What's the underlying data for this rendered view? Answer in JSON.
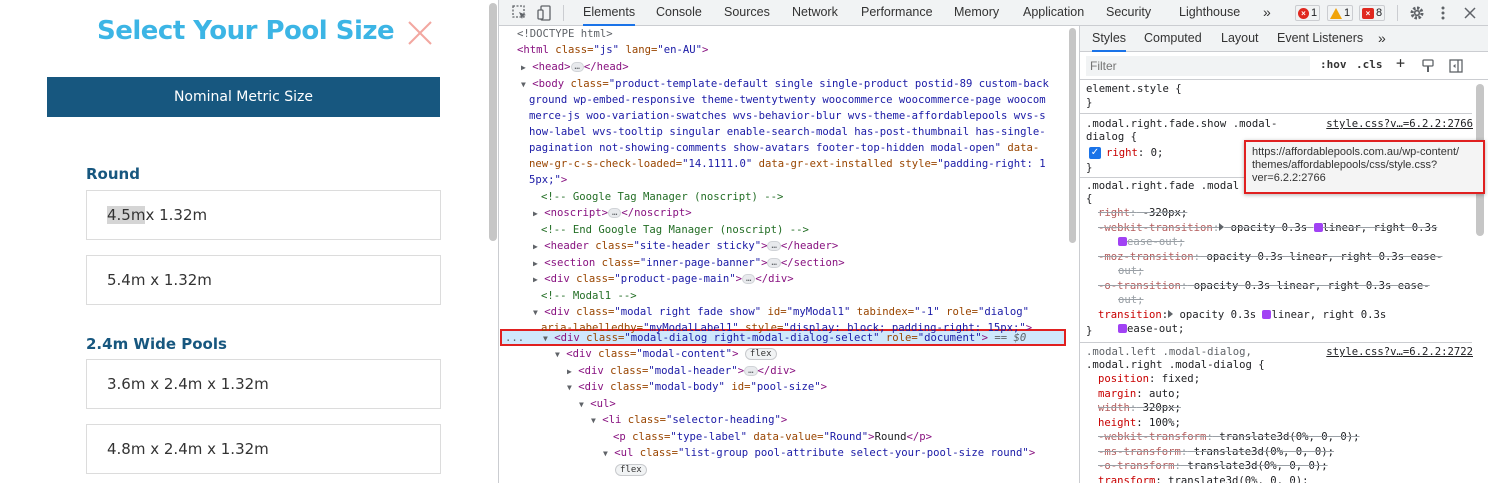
{
  "page": {
    "title": "Select Your Pool Size",
    "metric_button": "Nominal Metric Size",
    "sections": [
      {
        "heading": "Round",
        "options": [
          "4.5m x 1.32m",
          "5.4m x 1.32m"
        ]
      },
      {
        "heading": "2.4m Wide Pools",
        "options": [
          "3.6m x 2.4m x 1.32m",
          "4.8m x 2.4m x 1.32m"
        ]
      }
    ],
    "highlight_prefix": "4.5m",
    "highlight_suffix": " x 1.32m"
  },
  "devtools": {
    "tabs": [
      "Elements",
      "Console",
      "Sources",
      "Network",
      "Performance",
      "Memory",
      "Application",
      "Security",
      "Lighthouse"
    ],
    "more_tabs": "»",
    "badges": {
      "errors": "1",
      "warnings": "1",
      "issues": "8"
    },
    "elements": {
      "doctype": "<!DOCTYPE html>",
      "html_open": [
        "<html",
        " class=",
        "\"js\"",
        " lang=",
        "\"en-AU\"",
        ">"
      ],
      "head": [
        "<head>",
        "</head>"
      ],
      "body_lines": [
        "product-template-default single single-product postid-89 custom-back",
        "ground wp-embed-responsive theme-twentytwenty woocommerce woocommerce-page woocom",
        "merce-js woo-variation-swatches wvs-behavior-blur wvs-theme-affordablepools wvs-s",
        "how-label wvs-tooltip singular enable-search-modal has-post-thumbnail has-single-",
        "pagination not-showing-comments show-avatars footer-top-hidden modal-open\"",
        "new-gr-c-s-check-loaded=",
        "\"14.1111.0\"",
        "data-gr-ext-installed",
        "style=",
        "\"padding-right: 1",
        "5px;\""
      ],
      "comment_gtm": "<!-- Google Tag Manager (noscript) -->",
      "noscript": [
        "<noscript>",
        "</noscript>"
      ],
      "comment_gtm_end": "<!-- End Google Tag Manager (noscript) -->",
      "header_tag": [
        "<header",
        " class=",
        "\"site-header sticky\"",
        ">",
        "</header>"
      ],
      "section_tag": [
        "<section",
        " class=",
        "\"inner-page-banner\"",
        ">",
        "</section>"
      ],
      "div_main": [
        "<div",
        " class=",
        "\"product-page-main\"",
        ">",
        "</div>"
      ],
      "comment_modal": "<!-- Modal1 -->",
      "modal_line1": [
        "<div",
        " class=",
        "\"modal right fade show\"",
        " id=",
        "\"myModal1\"",
        " tabindex=",
        "\"-1\"",
        " role=",
        "\"dialog\""
      ],
      "modal_line2": [
        "aria-labelledby=",
        "\"myModalLabel1\"",
        " style=",
        "\"display: block; padding-right: 15px;\"",
        ">"
      ],
      "selected": [
        "<div",
        " class=",
        "\"modal-dialog right-modal-dialog-select\"",
        " role=",
        "\"document\"",
        ">",
        " == $0"
      ],
      "modal_content": [
        "<div",
        " class=",
        "\"modal-content\"",
        ">"
      ],
      "modal_header": [
        "<div",
        " class=",
        "\"modal-header\"",
        ">",
        "</div>"
      ],
      "modal_body": [
        "<div",
        " class=",
        "\"modal-body\"",
        " id=",
        "\"pool-size\"",
        ">"
      ],
      "ul_open": "<ul>",
      "li_heading": [
        "<li",
        " class=",
        "\"selector-heading\"",
        ">"
      ],
      "p_type": [
        "<p",
        " class=",
        "\"type-label\"",
        " data-value=",
        "\"Round\"",
        ">",
        "Round",
        "</p>"
      ],
      "ul_list": [
        "<ul",
        " class=",
        "\"list-group pool-attribute select-your-pool-size round\"",
        ">"
      ],
      "flex_label": "flex",
      "ellipsis": "…",
      "row_dots": "..."
    },
    "styles": {
      "tabs": [
        "Styles",
        "Computed",
        "Layout",
        "Event Listeners"
      ],
      "more_tabs": "»",
      "filter_placeholder": "Filter",
      "hov": ":hov",
      "cls": ".cls",
      "plus": "+",
      "element_style": "element.style {",
      "brace_close": "}",
      "brace_open": "{",
      "rule1_sel_a": ".modal.right.fade.show .modal-",
      "rule1_sel_b": "dialog {",
      "rule1_src": "style.css?v…=6.2.2:2766",
      "rule1_prop": "right",
      "rule1_val": " 0;",
      "tooltip_text": "https://affordablepools.com.au/wp-content/\nthemes/affordablepools/css/style.css?\nver=6.2.2:2766",
      "rule2_sel": ".modal.right.fade .modal",
      "rule2_lines": [
        {
          "prop": "right",
          "val": " -320px;",
          "struck": true
        },
        {
          "prop": "-webkit-transition",
          "val": " opacity 0.3s",
          "ease": "linear, right 0.3s",
          "struck": true
        },
        {
          "cont": "ease-out;",
          "struck": true
        },
        {
          "prop": "-moz-transition",
          "val": " opacity 0.3s linear, right 0.3s ease-",
          "struck": true
        },
        {
          "cont": "out;",
          "struck": true
        },
        {
          "prop": "-o-transition",
          "val": " opacity 0.3s linear, right 0.3s ease-",
          "struck": true
        },
        {
          "cont": "out;",
          "struck": true
        },
        {
          "prop": "transition",
          "val": " opacity 0.3s",
          "ease": "linear, right 0.3s",
          "struck": false
        },
        {
          "cont": "ease-out;",
          "struck": false
        }
      ],
      "rule3_sel_a": ".modal.left .modal-dialog,",
      "rule3_sel_b": ".modal.right .modal-dialog {",
      "rule3_src": "style.css?v…=6.2.2:2722",
      "rule3_lines": [
        {
          "prop": "position",
          "val": " fixed;",
          "struck": false
        },
        {
          "prop": "margin",
          "val": " auto;",
          "struck": false
        },
        {
          "prop": "width",
          "val": " 320px;",
          "struck": true
        },
        {
          "prop": "height",
          "val": " 100%;",
          "struck": false
        },
        {
          "prop": "-webkit-transform",
          "val": " translate3d(0%, 0, 0);",
          "struck": true
        },
        {
          "prop": "-ms-transform",
          "val": " translate3d(0%, 0, 0);",
          "struck": true
        },
        {
          "prop": "-o-transform",
          "val": " translate3d(0%, 0, 0);",
          "struck": true
        },
        {
          "prop": "transform",
          "val": " translate3d(0%, 0, 0);",
          "struck": false
        }
      ]
    }
  },
  "colors": {
    "title": "#3cb5e5",
    "navy": "#17577f",
    "highlight_red": "#e02020",
    "tab_active": "#1a73e8"
  }
}
